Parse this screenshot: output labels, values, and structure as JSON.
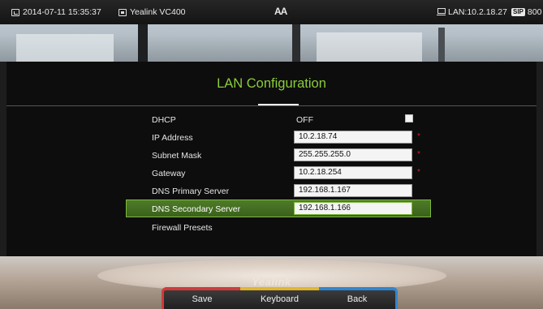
{
  "statusbar": {
    "datetime": "2014-07-11 15:35:37",
    "device": "Yealink VC400",
    "font_toggle": "AA",
    "lan": "LAN:10.2.18.27",
    "sip_badge": "SIP",
    "sip_number": "800"
  },
  "dialog": {
    "title": "LAN Configuration",
    "rows": [
      {
        "label": "DHCP",
        "value": "OFF",
        "type": "toggle",
        "checked": false
      },
      {
        "label": "IP Address",
        "value": "10.2.18.74",
        "required": "*"
      },
      {
        "label": "Subnet Mask",
        "value": "255.255.255.0",
        "required": "*"
      },
      {
        "label": "Gateway",
        "value": "10.2.18.254",
        "required": "*"
      },
      {
        "label": "DNS Primary Server",
        "value": "192.168.1.167"
      },
      {
        "label": "DNS Secondary Server",
        "value": "192.168.1.166",
        "selected": true
      },
      {
        "label": "Firewall Presets"
      }
    ]
  },
  "brand": "Yealink",
  "softkeys": [
    {
      "label": "Save",
      "color": "#cf3b3b"
    },
    {
      "label": "Keyboard",
      "color": "#e1b72b"
    },
    {
      "label": "Back",
      "color": "#2f86cf"
    }
  ]
}
